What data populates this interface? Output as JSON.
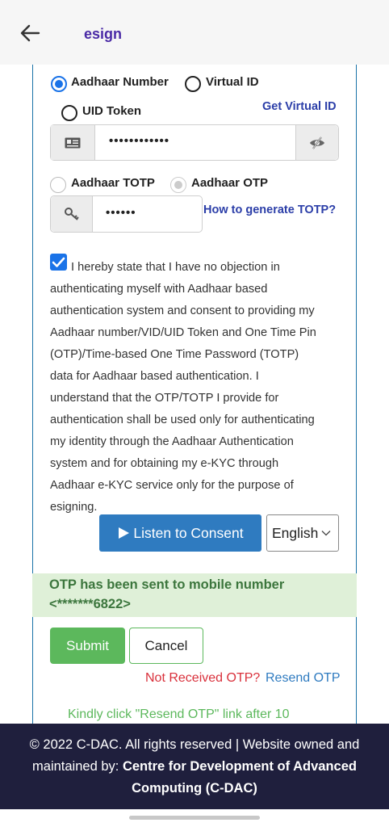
{
  "appbar": {
    "title": "esign"
  },
  "id_type": {
    "options": [
      "Aadhaar Number",
      "Virtual ID",
      "UID Token"
    ],
    "selected": "Aadhaar Number",
    "get_virtual_id": "Get Virtual ID"
  },
  "aadhaar_field": {
    "value": "••••••••••••"
  },
  "auth_type": {
    "options": [
      "Aadhaar TOTP",
      "Aadhaar OTP"
    ],
    "selected": "Aadhaar OTP",
    "totp_help": "How to generate TOTP?"
  },
  "otp_field": {
    "value": "••••••"
  },
  "consent": {
    "checked": true,
    "lines": [
      "I hereby state that I have no objection in",
      "authenticating myself with Aadhaar based",
      "authentication system and consent to providing my",
      "Aadhaar number/VID/UID Token and One Time Pin",
      "(OTP)/Time-based One Time Password (TOTP)",
      "data for Aadhaar based authentication. I",
      "understand that the OTP/TOTP I provide for",
      "authentication shall be used only for authenticating",
      "my identity through the Aadhaar Authentication",
      "system and for obtaining my e-KYC through",
      "Aadhaar e-KYC service only for the purpose of",
      "esigning."
    ],
    "listen_label": "Listen to Consent",
    "language": "English"
  },
  "otp_message": {
    "line1": "OTP has been sent to mobile number",
    "line2": "<*******6822>"
  },
  "actions": {
    "submit": "Submit",
    "cancel": "Cancel"
  },
  "resend": {
    "not_received": "Not Received OTP?",
    "link": "Resend OTP",
    "hint": "Kindly click \"Resend OTP\" link after 10"
  },
  "footer": {
    "line1": "© 2022 C-DAC. All rights reserved | Website owned and",
    "line2_prefix": "maintained by: ",
    "line2_bold": "Centre for Development of Advanced",
    "line3_bold": "Computing (C-DAC)"
  },
  "colors": {
    "accent": "#1a73e8",
    "success": "#5cb85c",
    "danger": "#d9303b",
    "footer_bg": "#1f1f3d"
  }
}
